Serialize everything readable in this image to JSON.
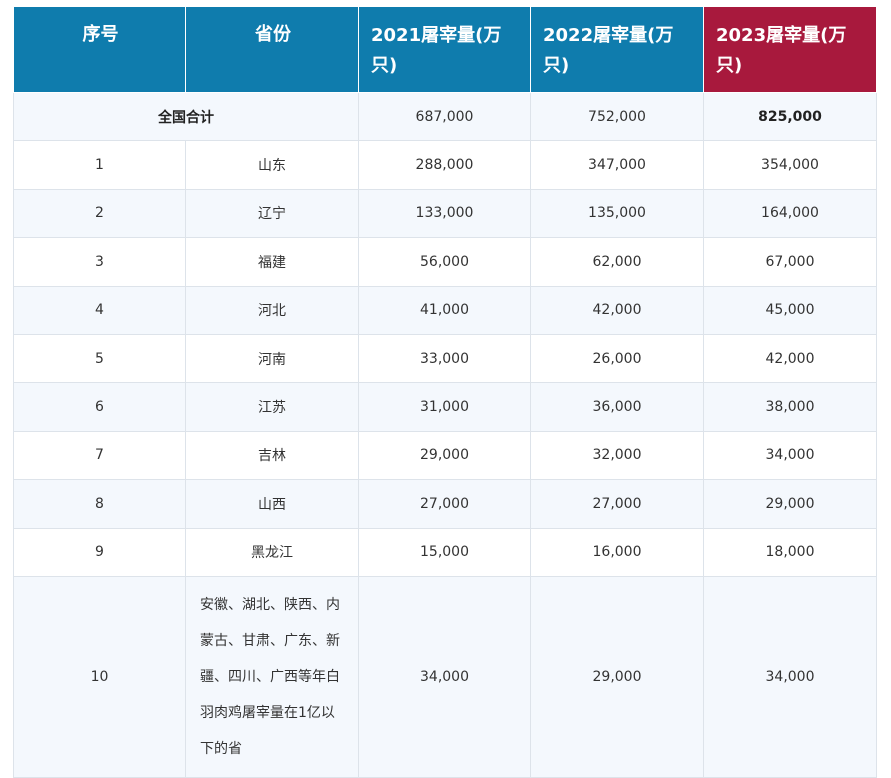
{
  "table": {
    "headers": {
      "index": "序号",
      "province": "省份",
      "y2021": "2021屠宰量(万只)",
      "y2022": "2022屠宰量(万只)",
      "y2023": "2023屠宰量(万只)"
    },
    "total": {
      "label": "全国合计",
      "y2021": "687,000",
      "y2022": "752,000",
      "y2023": "825,000"
    },
    "rows": [
      {
        "index": "1",
        "province": "山东",
        "y2021": "288,000",
        "y2022": "347,000",
        "y2023": "354,000"
      },
      {
        "index": "2",
        "province": "辽宁",
        "y2021": "133,000",
        "y2022": "135,000",
        "y2023": "164,000"
      },
      {
        "index": "3",
        "province": "福建",
        "y2021": "56,000",
        "y2022": "62,000",
        "y2023": "67,000"
      },
      {
        "index": "4",
        "province": "河北",
        "y2021": "41,000",
        "y2022": "42,000",
        "y2023": "45,000"
      },
      {
        "index": "5",
        "province": "河南",
        "y2021": "33,000",
        "y2022": "26,000",
        "y2023": "42,000"
      },
      {
        "index": "6",
        "province": "江苏",
        "y2021": "31,000",
        "y2022": "36,000",
        "y2023": "38,000"
      },
      {
        "index": "7",
        "province": "吉林",
        "y2021": "29,000",
        "y2022": "32,000",
        "y2023": "34,000"
      },
      {
        "index": "8",
        "province": "山西",
        "y2021": "27,000",
        "y2022": "27,000",
        "y2023": "29,000"
      },
      {
        "index": "9",
        "province": "黑龙江",
        "y2021": "15,000",
        "y2022": "16,000",
        "y2023": "18,000"
      },
      {
        "index": "10",
        "province": "安徽、湖北、陕西、内蒙古、甘肃、广东、新疆、四川、广西等年白羽肉鸡屠宰量在1亿以下的省",
        "y2021": "34,000",
        "y2022": "29,000",
        "y2023": "34,000"
      }
    ]
  }
}
